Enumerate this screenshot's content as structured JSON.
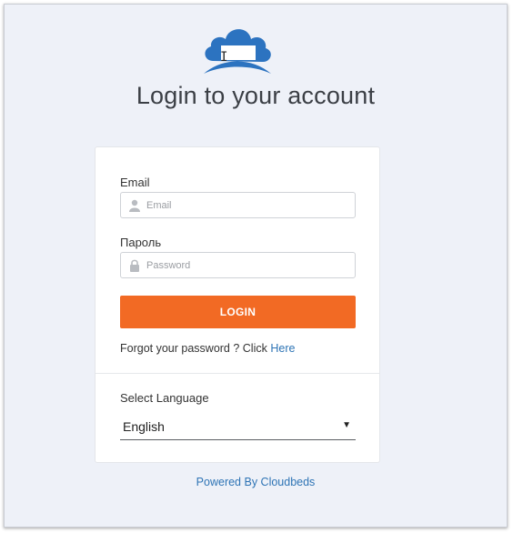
{
  "page": {
    "title": "Login to your account",
    "logo_icon": "cloud-logo-icon",
    "accent_color": "#f26a24",
    "link_color": "#2e74b5"
  },
  "form": {
    "email_label": "Email",
    "email_placeholder": "Email",
    "email_icon": "user-icon",
    "password_label": "Пароль",
    "password_placeholder": "Password",
    "password_icon": "lock-icon",
    "login_label": "LOGIN",
    "forgot_text": "Forgot your password ? Click ",
    "forgot_link": "Here"
  },
  "language": {
    "label": "Select Language",
    "selected": "English",
    "caret_icon": "caret-down-icon"
  },
  "footer": {
    "powered_by": "Powered By Cloudbeds"
  }
}
